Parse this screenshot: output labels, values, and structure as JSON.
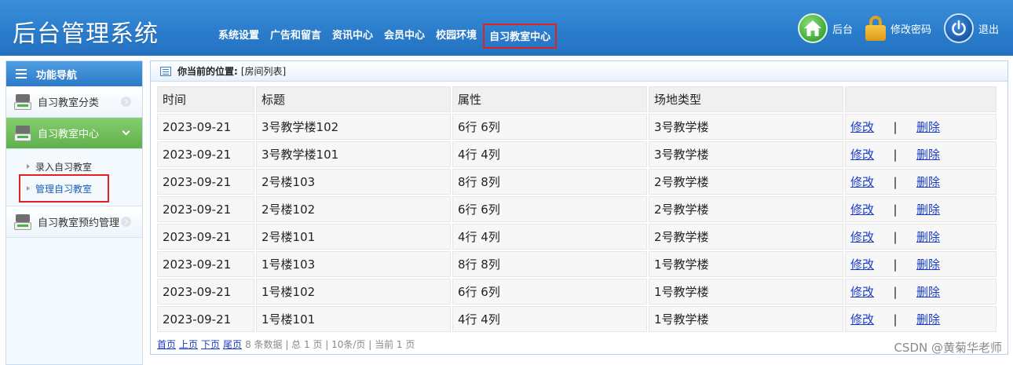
{
  "header": {
    "brand": "后台管理系统",
    "nav": [
      {
        "label": "系统设置",
        "active": false
      },
      {
        "label": "广告和留言",
        "active": false
      },
      {
        "label": "资讯中心",
        "active": false
      },
      {
        "label": "会员中心",
        "active": false
      },
      {
        "label": "校园环境",
        "active": false
      },
      {
        "label": "自习教室中心",
        "active": true
      }
    ],
    "actions": {
      "home_label": "后台",
      "password_label": "修改密码",
      "logout_label": "退出"
    }
  },
  "sidebar": {
    "title": "功能导航",
    "groups": [
      {
        "label": "自习教室分类",
        "active": false
      },
      {
        "label": "自习教室中心",
        "active": true
      },
      {
        "label": "自习教室预约管理",
        "active": false
      }
    ],
    "sub_items": [
      {
        "label": "录入自习教室",
        "current": false
      },
      {
        "label": "管理自习教室",
        "current": true
      }
    ]
  },
  "main": {
    "breadcrumb_key": "你当前的位置:",
    "breadcrumb_value": "[房间列表]",
    "columns": [
      "时间",
      "标题",
      "属性",
      "场地类型",
      ""
    ],
    "rows": [
      {
        "time": "2023-09-21",
        "title": "3号教学楼102",
        "attr": "6行 6列",
        "type": "3号教学楼"
      },
      {
        "time": "2023-09-21",
        "title": "3号教学楼101",
        "attr": "4行 4列",
        "type": "3号教学楼"
      },
      {
        "time": "2023-09-21",
        "title": "2号楼103",
        "attr": "8行 8列",
        "type": "2号教学楼"
      },
      {
        "time": "2023-09-21",
        "title": "2号楼102",
        "attr": "6行 6列",
        "type": "2号教学楼"
      },
      {
        "time": "2023-09-21",
        "title": "2号楼101",
        "attr": "4行 4列",
        "type": "2号教学楼"
      },
      {
        "time": "2023-09-21",
        "title": "1号楼103",
        "attr": "8行 8列",
        "type": "1号教学楼"
      },
      {
        "time": "2023-09-21",
        "title": "1号楼102",
        "attr": "6行 6列",
        "type": "1号教学楼"
      },
      {
        "time": "2023-09-21",
        "title": "1号楼101",
        "attr": "4行 4列",
        "type": "1号教学楼"
      }
    ],
    "edit_label": "修改",
    "separator": "|",
    "delete_label": "删除",
    "pager": {
      "first": "首页",
      "prev": "上页",
      "next": "下页",
      "last": "尾页",
      "summary": "8 条数据 | 总 1 页 | 10条/页 | 当前 1 页"
    }
  },
  "watermark": "CSDN @黄菊华老师",
  "colors": {
    "header_blue": "#2a7ccb",
    "active_green": "#5fb14b",
    "highlight_red": "#e02222",
    "link_blue": "#1a3cc7"
  }
}
